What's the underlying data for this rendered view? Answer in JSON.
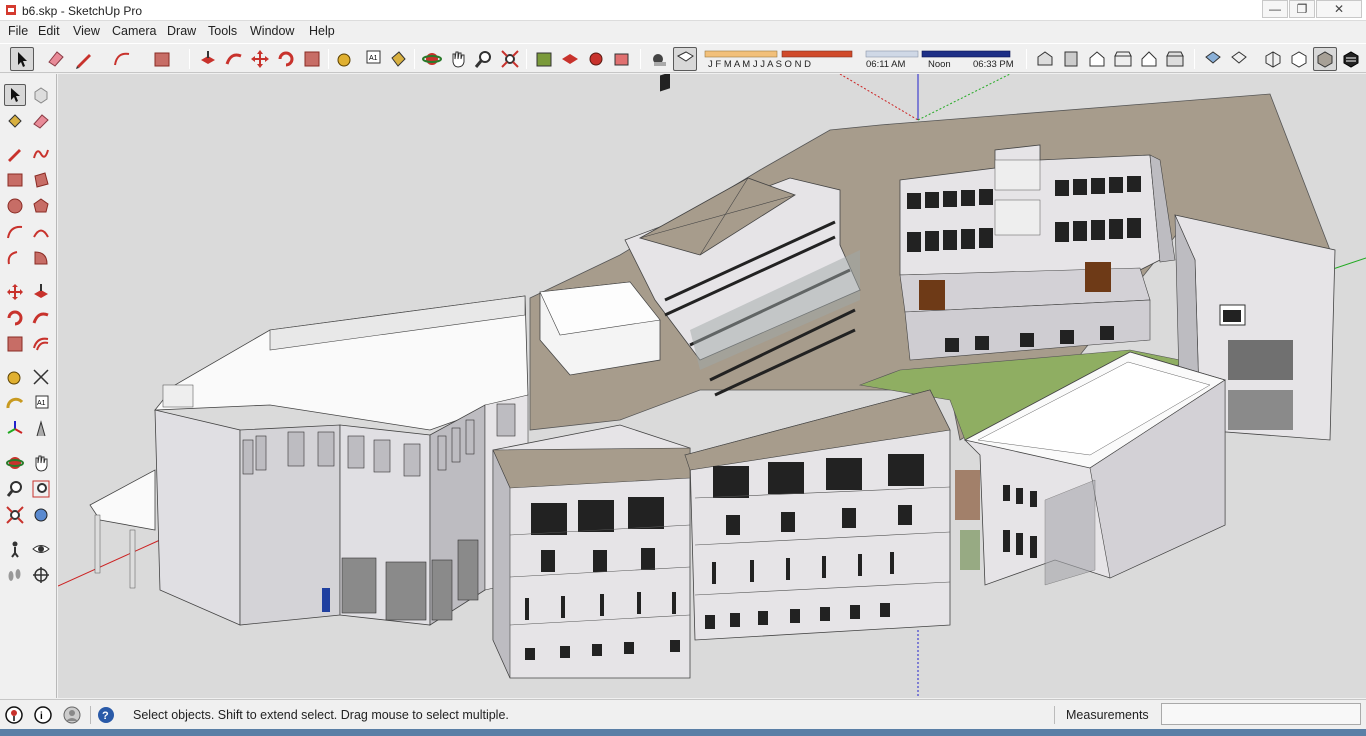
{
  "window": {
    "title": "b6.skp - SketchUp Pro",
    "minimize_label": "—",
    "maximize_label": "❐",
    "close_label": "✕"
  },
  "menu": {
    "file": "File",
    "edit": "Edit",
    "view": "View",
    "camera": "Camera",
    "draw": "Draw",
    "tools": "Tools",
    "window": "Window",
    "help": "Help"
  },
  "shadow_settings": {
    "months": "J F M A M J J A S O N D",
    "time_start": "06:11 AM",
    "time_noon": "Noon",
    "time_end": "06:33 PM"
  },
  "statusbar": {
    "message": "Select objects. Shift to extend select. Drag mouse to select multiple.",
    "measurements_label": "Measurements",
    "measurements_value": ""
  },
  "colors": {
    "roof": "#a79c8c",
    "wall": "#e6e4e7",
    "wall_shade": "#bdbcc1",
    "grass": "#8fae62",
    "sky": "#dadada",
    "axis_blue": "#2222cc",
    "axis_red": "#cc2222",
    "axis_green": "#22aa22"
  }
}
